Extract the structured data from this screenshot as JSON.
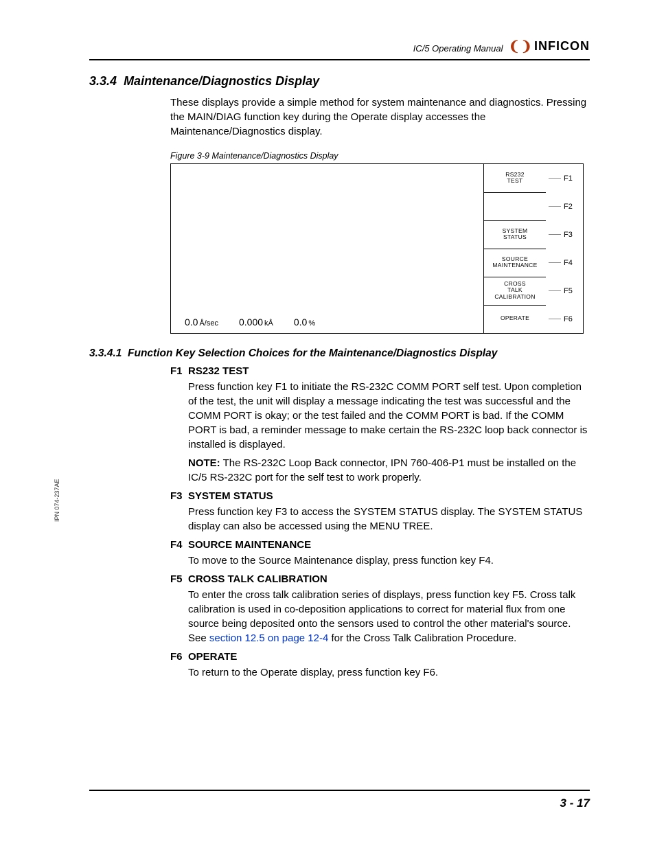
{
  "header": {
    "manual_title": "IC/5 Operating Manual",
    "brand": "INFICON"
  },
  "section": {
    "number": "3.3.4",
    "title": "Maintenance/Diagnostics Display",
    "intro": "These displays provide a simple method for system maintenance and diagnostics. Pressing the MAIN/DIAG function key during the Operate display accesses the Maintenance/Diagnostics display."
  },
  "figure": {
    "caption": "Figure 3-9  Maintenance/Diagnostics Display",
    "status": {
      "rate_value": "0.0",
      "rate_unit": "Å/sec",
      "thick_value": "0.000",
      "thick_unit": "kÅ",
      "pct_value": "0.0",
      "pct_unit": "%"
    },
    "fkeys": [
      {
        "label": "RS232\nTEST",
        "key": "F1"
      },
      {
        "label": "",
        "key": "F2"
      },
      {
        "label": "SYSTEM\nSTATUS",
        "key": "F3"
      },
      {
        "label": "SOURCE\nMAINTENANCE",
        "key": "F4"
      },
      {
        "label": "CROSS\nTALK\nCALIBRATION",
        "key": "F5"
      },
      {
        "label": "OPERATE",
        "key": "F6"
      }
    ]
  },
  "subsection": {
    "number": "3.3.4.1",
    "title": "Function Key Selection Choices for the Maintenance/Diagnostics Display",
    "items": [
      {
        "key": "F1",
        "name": "RS232 TEST",
        "body": "Press function key F1 to initiate the RS-232C COMM PORT self test. Upon completion of the test, the unit will display a message indicating the test was successful and the COMM PORT is okay; or the test failed and the COMM PORT is bad. If the COMM PORT is bad, a reminder message to make certain the RS-232C loop back connector is installed is displayed.",
        "note_label": "NOTE:",
        "note": "The RS-232C Loop Back connector, IPN 760-406-P1 must be installed on the IC/5 RS-232C port for the self test to work properly."
      },
      {
        "key": "F3",
        "name": "SYSTEM STATUS",
        "body": "Press function key F3 to access the SYSTEM STATUS display. The SYSTEM STATUS display can also be accessed using the MENU TREE."
      },
      {
        "key": "F4",
        "name": "SOURCE MAINTENANCE",
        "body": "To move to the Source Maintenance display, press function key F4."
      },
      {
        "key": "F5",
        "name": "CROSS TALK CALIBRATION",
        "body_pre": "To enter the cross talk calibration series of displays, press function key F5. Cross talk calibration is used in co-deposition applications to correct for material flux from one source being deposited onto the sensors used to control the other material's source. See ",
        "link": "section 12.5 on page 12-4",
        "body_post": " for the Cross Talk Calibration Procedure."
      },
      {
        "key": "F6",
        "name": "OPERATE",
        "body": "To return to the Operate display, press function key F6."
      }
    ]
  },
  "sidetext": "IPN 074-237AE",
  "pagenum": "3 - 17"
}
